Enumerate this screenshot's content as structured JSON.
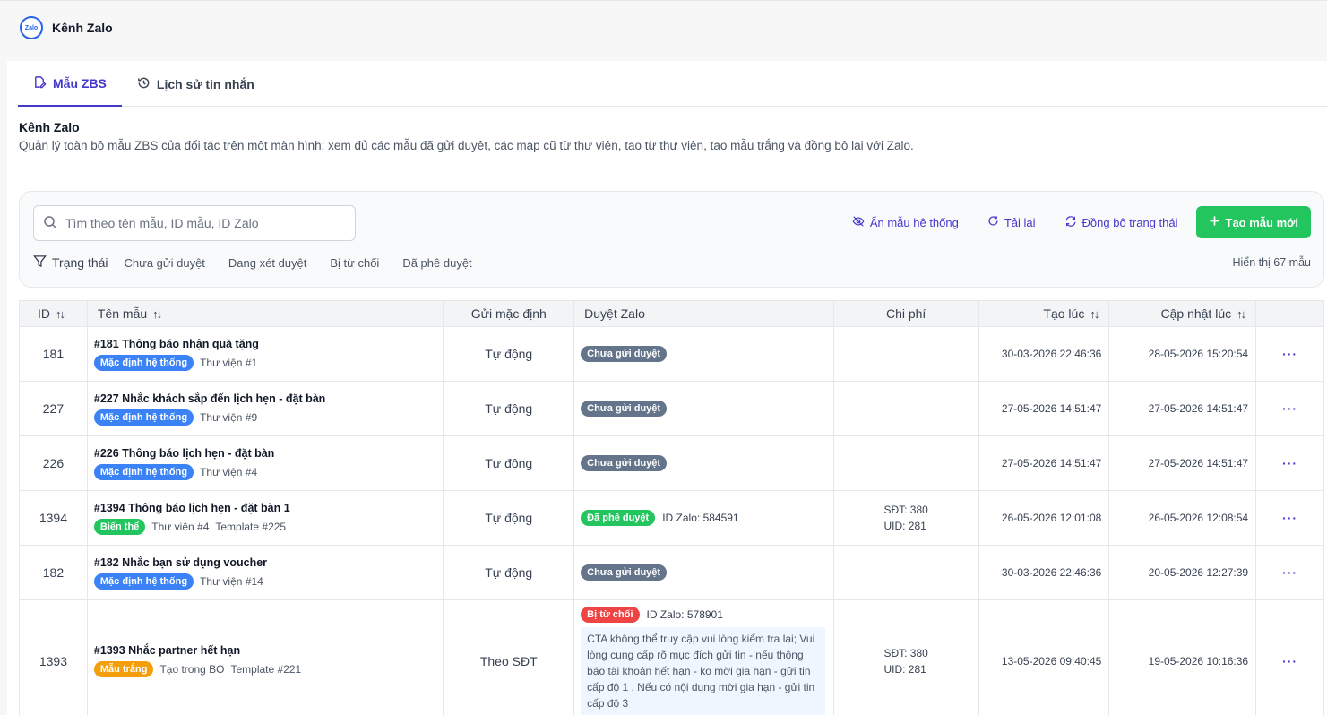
{
  "app": {
    "title": "Kênh Zalo",
    "logo_text": "Zalo"
  },
  "tabs": [
    {
      "label": "Mẫu ZBS",
      "icon": "edit-icon",
      "active": true
    },
    {
      "label": "Lịch sử tin nhắn",
      "icon": "history-icon",
      "active": false
    }
  ],
  "section": {
    "title": "Kênh Zalo",
    "description": "Quản lý toàn bộ mẫu ZBS của đối tác trên một màn hình: xem đủ các mẫu đã gửi duyệt, các map cũ từ thư viện, tạo từ thư viện, tạo mẫu trắng và đồng bộ lại với Zalo."
  },
  "toolbar": {
    "search_placeholder": "Tìm theo tên mẫu, ID mẫu, ID Zalo",
    "hide_system": "Ẩn mẫu hệ thống",
    "reload": "Tải lại",
    "sync_status": "Đồng bộ trạng thái",
    "create_new": "Tạo mẫu mới"
  },
  "filters": {
    "label": "Trạng thái",
    "options": [
      "Chưa gửi duyệt",
      "Đang xét duyệt",
      "Bị từ chối",
      "Đã phê duyệt"
    ],
    "count_text": "Hiển thị 67 mẫu"
  },
  "table": {
    "headers": {
      "id": "ID",
      "name": "Tên mẫu",
      "send_default": "Gửi mặc định",
      "zalo_review": "Duyệt Zalo",
      "cost": "Chi phí",
      "created": "Tạo lúc",
      "updated": "Cập nhật lúc"
    },
    "rows": [
      {
        "id": "181",
        "name": "#181 Thông báo nhận quà tặng",
        "badge": "Mặc định hệ thống",
        "meta1": "Thư viện #1",
        "meta2": "",
        "send": "Tự động",
        "status": "Chưa gửi duyệt",
        "zalo_id": "",
        "reason": "",
        "cost1": "",
        "cost2": "",
        "created": "30-03-2026 22:46:36",
        "updated": "28-05-2026 15:20:54"
      },
      {
        "id": "227",
        "name": "#227 Nhắc khách sắp đến lịch hẹn - đặt bàn",
        "badge": "Mặc định hệ thống",
        "meta1": "Thư viện #9",
        "meta2": "",
        "send": "Tự động",
        "status": "Chưa gửi duyệt",
        "zalo_id": "",
        "reason": "",
        "cost1": "",
        "cost2": "",
        "created": "27-05-2026 14:51:47",
        "updated": "27-05-2026 14:51:47"
      },
      {
        "id": "226",
        "name": "#226 Thông báo lịch hẹn - đặt bàn",
        "badge": "Mặc định hệ thống",
        "meta1": "Thư viện #4",
        "meta2": "",
        "send": "Tự động",
        "status": "Chưa gửi duyệt",
        "zalo_id": "",
        "reason": "",
        "cost1": "",
        "cost2": "",
        "created": "27-05-2026 14:51:47",
        "updated": "27-05-2026 14:51:47"
      },
      {
        "id": "1394",
        "name": "#1394 Thông báo lịch hẹn - đặt bàn 1",
        "badge": "Biến thể",
        "meta1": "Thư viện #4",
        "meta2": "Template #225",
        "send": "Tự động",
        "status": "Đã phê duyệt",
        "zalo_id": "ID Zalo: 584591",
        "reason": "",
        "cost1": "SĐT: 380",
        "cost2": "UID: 281",
        "created": "26-05-2026 12:01:08",
        "updated": "26-05-2026 12:08:54"
      },
      {
        "id": "182",
        "name": "#182 Nhắc bạn sử dụng voucher",
        "badge": "Mặc định hệ thống",
        "meta1": "Thư viện #14",
        "meta2": "",
        "send": "Tự động",
        "status": "Chưa gửi duyệt",
        "zalo_id": "",
        "reason": "",
        "cost1": "",
        "cost2": "",
        "created": "30-03-2026 22:46:36",
        "updated": "20-05-2026 12:27:39"
      },
      {
        "id": "1393",
        "name": "#1393 Nhắc partner hết hạn",
        "badge": "Mẫu trắng",
        "meta1": "Tạo trong BO",
        "meta2": "Template #221",
        "send": "Theo SĐT",
        "status": "Bị từ chối",
        "zalo_id": "ID Zalo: 578901",
        "reason": "CTA không thể truy cập vui lòng kiểm tra lại; Vui lòng cung cấp rõ mục đích gửi tin - nếu thông báo tài khoản hết hạn - ko mời gia hạn - gửi tin cấp độ 1 . Nếu có nội dung mời gia hạn - gửi tin cấp độ 3",
        "cost1": "SĐT: 380",
        "cost2": "UID: 281",
        "created": "13-05-2026 09:40:45",
        "updated": "19-05-2026 10:16:36"
      }
    ],
    "row_menu": "···"
  },
  "colors": {
    "accent": "#4338ca",
    "primary_button": "#22c55e",
    "badge_system": "#3b82f6",
    "badge_variant": "#22c55e",
    "badge_blank": "#f59e0b",
    "status_pending": "#64748b",
    "status_approved": "#22c55e",
    "status_rejected": "#ef4444"
  }
}
